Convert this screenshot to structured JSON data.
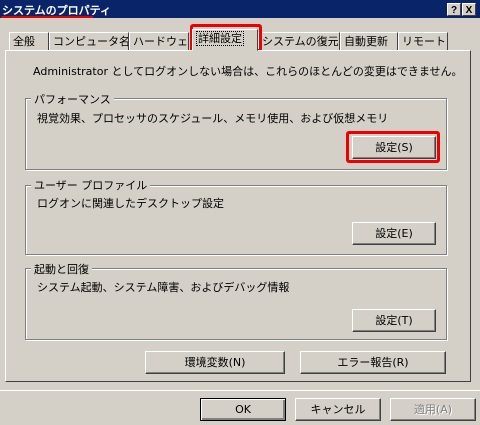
{
  "window": {
    "title": "システムのプロパティ",
    "help_glyph": "?",
    "close_glyph": "X"
  },
  "tabs": [
    {
      "label": "全般"
    },
    {
      "label": "コンピュータ名"
    },
    {
      "label": "ハードウェア"
    },
    {
      "label": "詳細設定"
    },
    {
      "label": "システムの復元"
    },
    {
      "label": "自動更新"
    },
    {
      "label": "リモート"
    }
  ],
  "active_tab": "詳細設定",
  "notice": "Administrator としてログオンしない場合は、これらのほとんどの変更はできません。",
  "groups": {
    "performance": {
      "legend": "パフォーマンス",
      "desc": "視覚効果、プロセッサのスケジュール、メモリ使用、および仮想メモリ",
      "button": "設定(S)"
    },
    "profile": {
      "legend": "ユーザー プロファイル",
      "desc": "ログオンに関連したデスクトップ設定",
      "button": "設定(E)"
    },
    "startup": {
      "legend": "起動と回復",
      "desc": "システム起動、システム障害、およびデバッグ情報",
      "button": "設定(T)"
    }
  },
  "buttons": {
    "env": "環境変数(N)",
    "error": "エラー報告(R)",
    "ok": "OK",
    "cancel": "キャンセル",
    "apply": "適用(A)"
  },
  "colors": {
    "titlebar": "#0a246a",
    "face": "#d4d0c8",
    "highlight": "#ee0000"
  }
}
